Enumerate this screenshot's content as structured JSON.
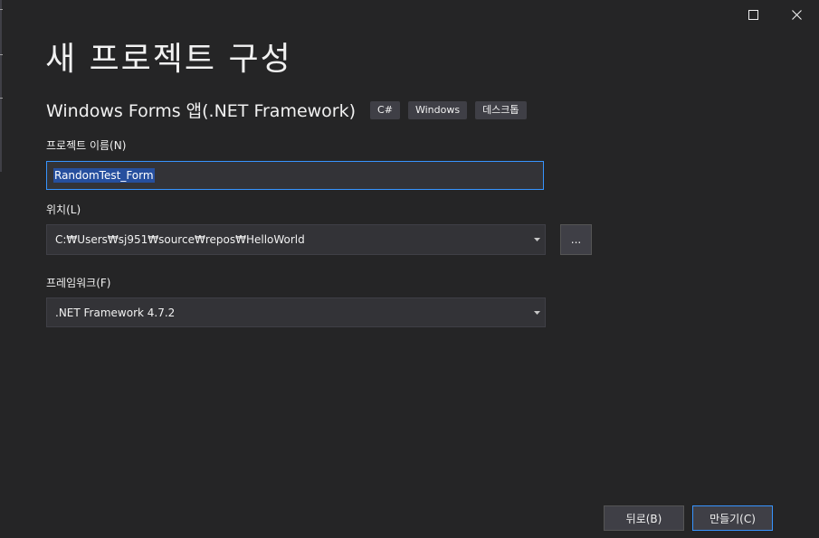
{
  "window": {
    "maximize_icon": "maximize-icon",
    "close_icon": "close-icon"
  },
  "header": {
    "title": "새 프로젝트 구성"
  },
  "template": {
    "name": "Windows Forms 앱(.NET Framework)",
    "tags": [
      "C#",
      "Windows",
      "데스크톱"
    ]
  },
  "form": {
    "project_name": {
      "label": "프로젝트 이름(N)",
      "value": "RandomTest_Form"
    },
    "location": {
      "label": "위치(L)",
      "value": "C:₩Users₩sj951₩source₩repos₩HelloWorld",
      "browse_label": "..."
    },
    "framework": {
      "label": "프레임워크(F)",
      "value": ".NET Framework 4.7.2"
    }
  },
  "footer": {
    "back_label": "뒤로(B)",
    "create_label": "만들기(C)"
  },
  "colors": {
    "background": "#252526",
    "input_background": "#333337",
    "accent": "#3794ff",
    "selection": "#264f9e",
    "button": "#3f3f46"
  }
}
